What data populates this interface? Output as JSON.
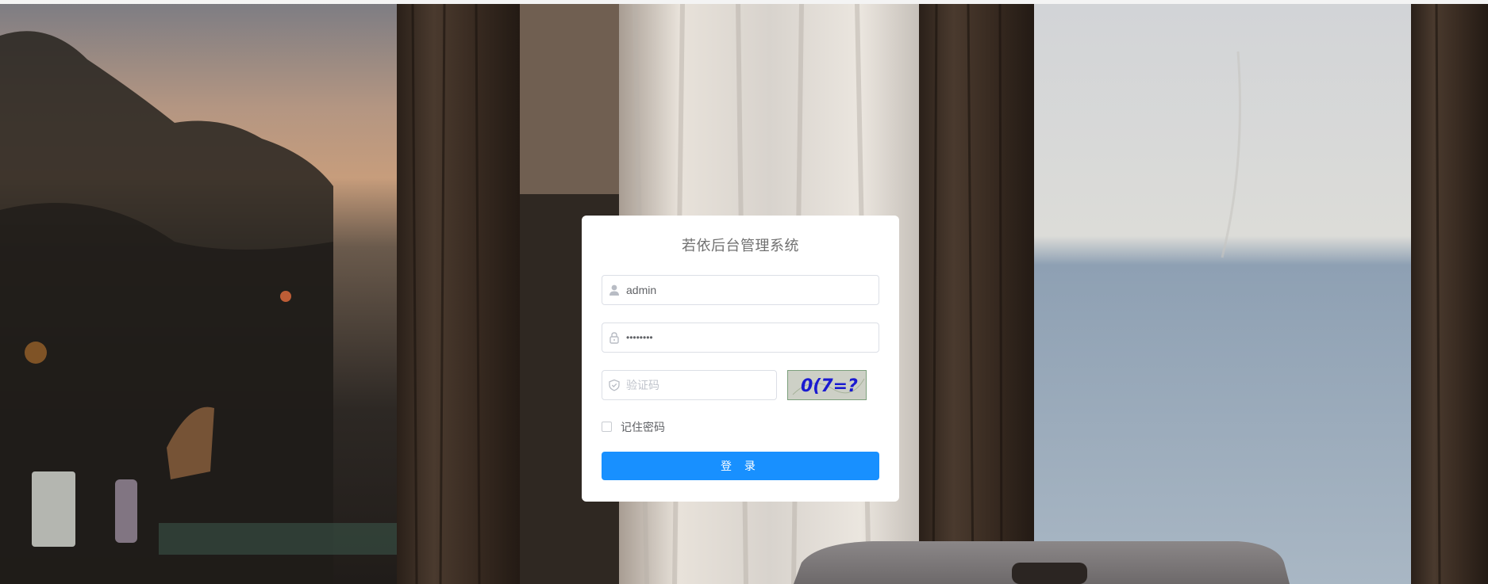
{
  "login": {
    "title": "若依后台管理系统",
    "username": {
      "value": "admin",
      "icon": "user-icon"
    },
    "password": {
      "value": "••••••••",
      "icon": "lock-icon"
    },
    "captcha": {
      "placeholder": "验证码",
      "icon": "shield-icon",
      "image_text": "0(7=?"
    },
    "remember_label": "记住密码",
    "remember_checked": false,
    "submit_label": "登 录"
  },
  "colors": {
    "primary": "#1890ff",
    "card_bg": "#ffffff",
    "border": "#dcdfe6",
    "text": "#606266",
    "placeholder": "#c0c4cc",
    "title": "#707070"
  }
}
